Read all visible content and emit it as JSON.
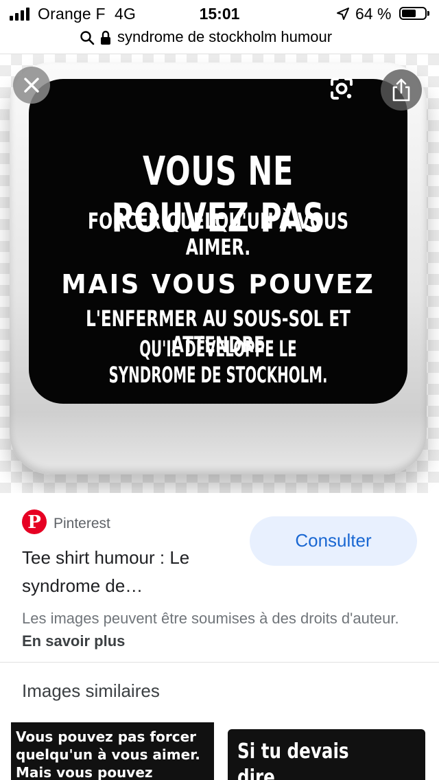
{
  "status_bar": {
    "carrier": "Orange F",
    "network": "4G",
    "time": "15:01",
    "battery": "64 %",
    "battery_level": 0.64
  },
  "url_bar": {
    "query": "syndrome de stockholm humour"
  },
  "image": {
    "line1": "VOUS NE POUVEZ PAS",
    "line2": "FORCER QUELQU'UN À VOUS AIMER.",
    "line3": "MAIS VOUS POUVEZ",
    "line4": "L'ENFERMER AU SOUS-SOL ET ATTENDRE",
    "line5": "QU'IL DÉVELOPPE LE SYNDROME DE STOCKHOLM."
  },
  "result": {
    "source": "Pinterest",
    "title": "Tee shirt humour : Le syndrome de…",
    "visit_button": "Consulter",
    "rights_text": "Les images peuvent être soumises à des droits d'auteur.",
    "learn_more": "En savoir plus"
  },
  "similar": {
    "heading": "Images similaires",
    "items": [
      {
        "text": "Vous pouvez pas forcer\nquelqu'un à vous aimer.\nMais vous pouvez"
      },
      {
        "text": "Si tu devais dire\n\" JE T'AIME \" à"
      }
    ]
  },
  "colors": {
    "accent": "#1967d2",
    "button_bg": "#e8f0fe",
    "pinterest": "#e60023"
  }
}
